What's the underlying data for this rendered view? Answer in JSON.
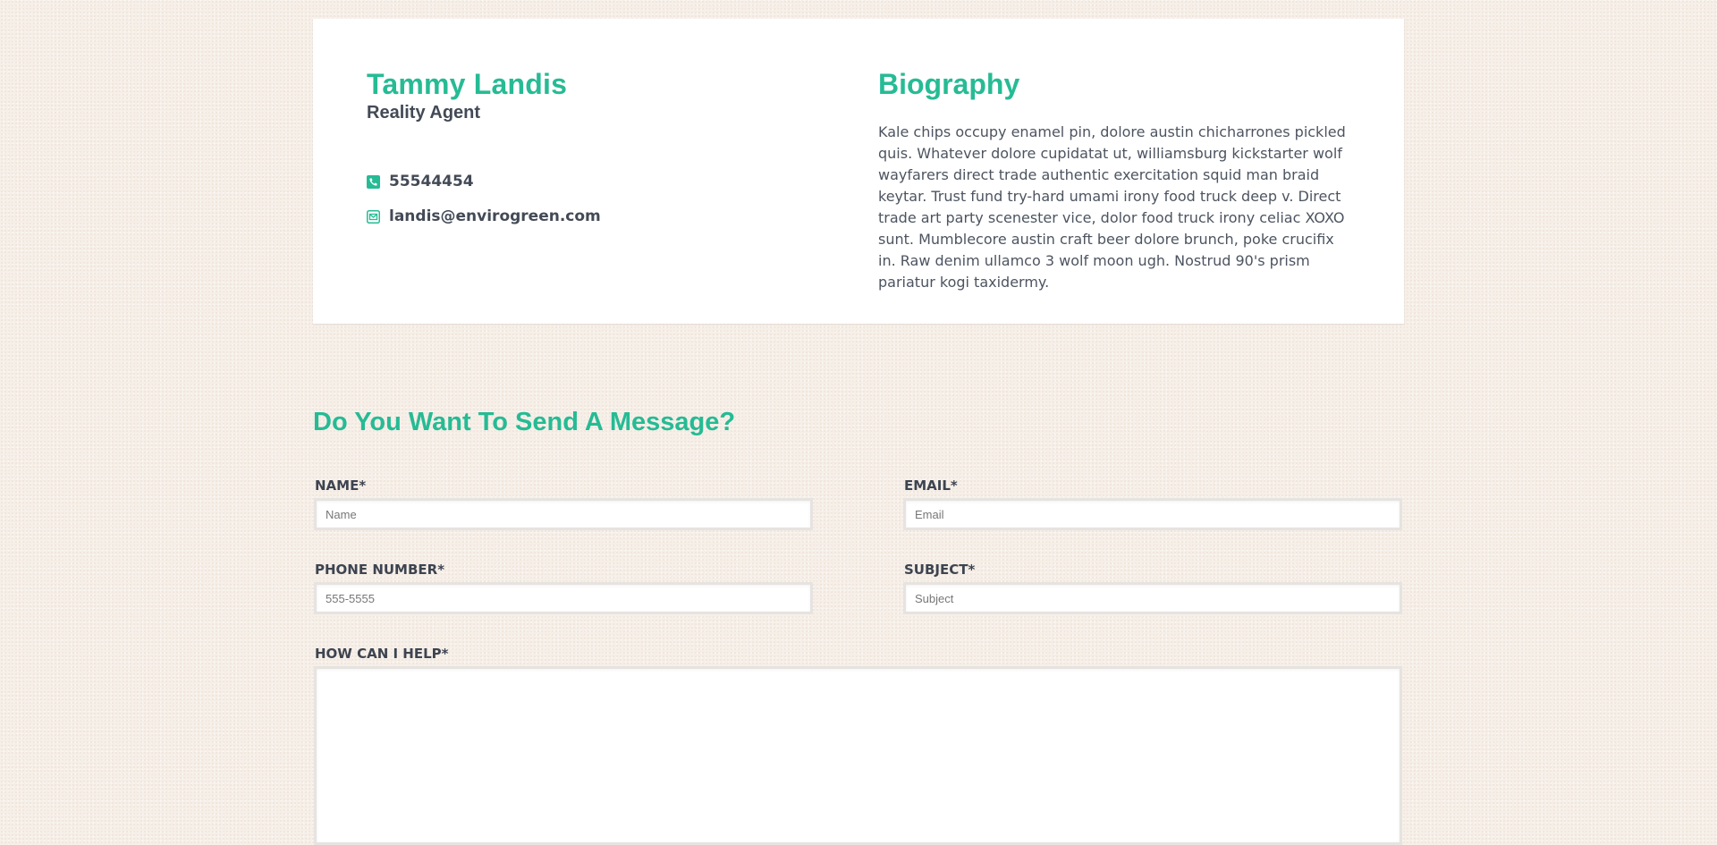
{
  "agent": {
    "name": "Tammy Landis",
    "role": "Reality Agent",
    "phone": "55544454",
    "email": "landis@envirogreen.com"
  },
  "biography": {
    "title": "Biography",
    "text": "Kale chips occupy enamel pin, dolore austin chicharrones pickled quis. Whatever dolore cupidatat ut, williamsburg kickstarter wolf wayfarers direct trade authentic exercitation squid man braid keytar. Trust fund try-hard umami irony food truck deep v. Direct trade art party scenester vice, dolor food truck irony celiac XOXO sunt. Mumblecore austin craft beer dolore brunch, poke crucifix in. Raw denim ullamco 3 wolf moon ugh. Nostrud 90's prism pariatur kogi taxidermy."
  },
  "form": {
    "title": "Do You Want To Send A Message?",
    "name_label": "NAME*",
    "name_placeholder": "Name",
    "email_label": "EMAIL*",
    "email_placeholder": "Email",
    "phone_label": "PHONE NUMBER*",
    "phone_placeholder": "555-5555",
    "subject_label": "SUBJECT*",
    "subject_placeholder": "Subject",
    "help_label": "HOW CAN I HELP*"
  },
  "colors": {
    "accent": "#26bb94",
    "text": "#434a56",
    "background": "#f6efe8"
  },
  "icons": {
    "phone": "phone-square-icon",
    "email": "envelope-square-icon"
  }
}
